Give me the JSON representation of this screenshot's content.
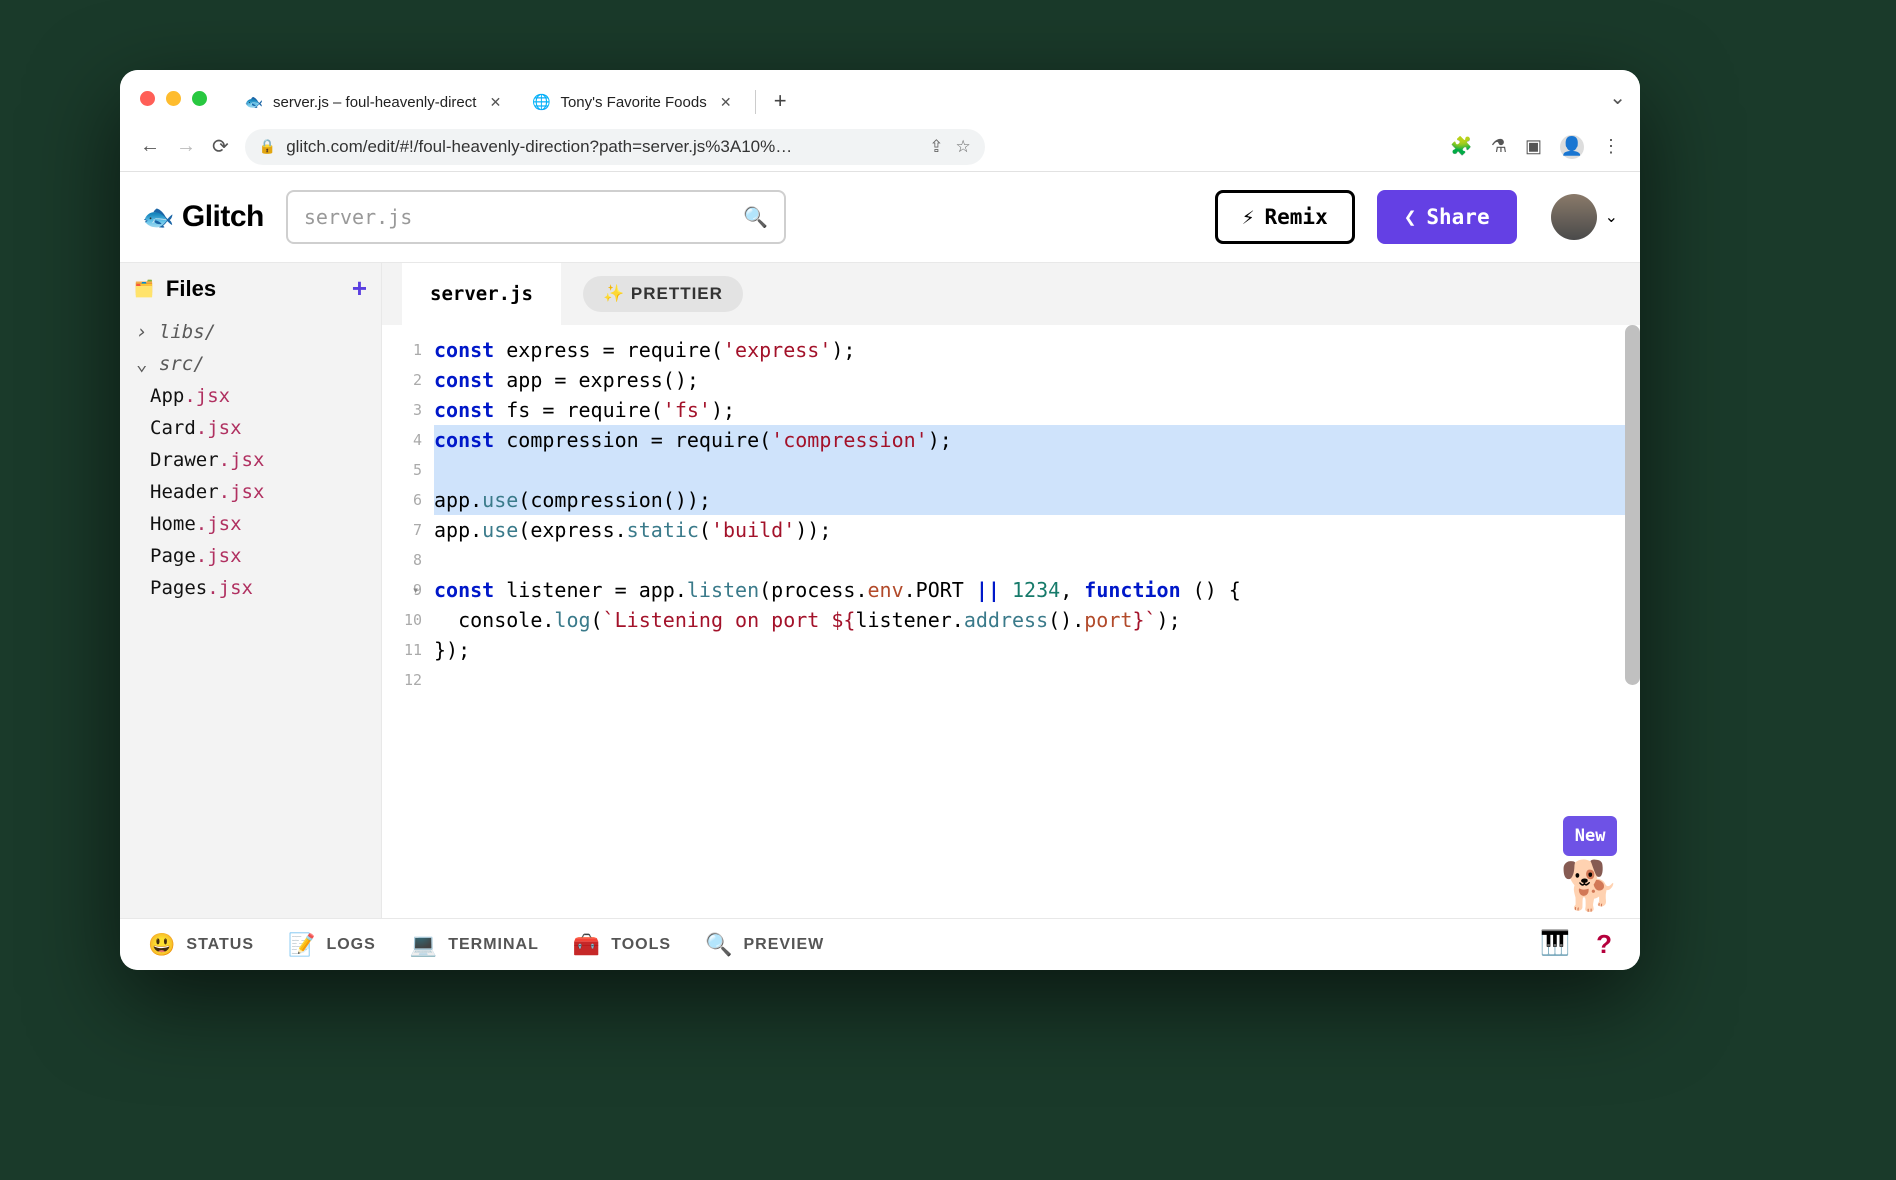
{
  "browser": {
    "tabs": [
      {
        "label": "server.js – foul-heavenly-direct",
        "active": true
      },
      {
        "label": "Tony's Favorite Foods",
        "active": false
      }
    ],
    "url": "glitch.com/edit/#!/foul-heavenly-direction?path=server.js%3A10%…"
  },
  "header": {
    "logo": "Glitch",
    "search_placeholder": "server.js",
    "remix_label": "Remix",
    "share_label": "Share"
  },
  "sidebar": {
    "title": "Files",
    "folders": [
      {
        "name": "libs/",
        "expanded": false
      },
      {
        "name": "src/",
        "expanded": true,
        "files": [
          {
            "base": "App",
            "ext": ".jsx"
          },
          {
            "base": "Card",
            "ext": ".jsx"
          },
          {
            "base": "Drawer",
            "ext": ".jsx"
          },
          {
            "base": "Header",
            "ext": ".jsx"
          },
          {
            "base": "Home",
            "ext": ".jsx"
          },
          {
            "base": "Page",
            "ext": ".jsx"
          },
          {
            "base": "Pages",
            "ext": ".jsx"
          }
        ]
      }
    ]
  },
  "editor": {
    "tab": "server.js",
    "prettier": "PRETTIER",
    "lines": [
      {
        "n": 1,
        "hl": false,
        "segs": [
          [
            "kw",
            "const"
          ],
          [
            "",
            " express = require("
          ],
          [
            "str",
            "'express'"
          ],
          [
            "",
            ");"
          ]
        ]
      },
      {
        "n": 2,
        "hl": false,
        "segs": [
          [
            "kw",
            "const"
          ],
          [
            "",
            " app = express();"
          ]
        ]
      },
      {
        "n": 3,
        "hl": false,
        "segs": [
          [
            "kw",
            "const"
          ],
          [
            "",
            " fs = require("
          ],
          [
            "str",
            "'fs'"
          ],
          [
            "",
            ");"
          ]
        ]
      },
      {
        "n": 4,
        "hl": true,
        "segs": [
          [
            "kw",
            "const"
          ],
          [
            "",
            " compression = require("
          ],
          [
            "str",
            "'compression'"
          ],
          [
            "",
            ");"
          ]
        ]
      },
      {
        "n": 5,
        "hl": true,
        "segs": [
          [
            "",
            ""
          ]
        ]
      },
      {
        "n": 6,
        "hl": true,
        "segs": [
          [
            "",
            "app."
          ],
          [
            "fn",
            "use"
          ],
          [
            "",
            "(compression());"
          ]
        ]
      },
      {
        "n": 7,
        "hl": false,
        "segs": [
          [
            "",
            "app."
          ],
          [
            "fn",
            "use"
          ],
          [
            "",
            "(express."
          ],
          [
            "fn",
            "static"
          ],
          [
            "",
            "("
          ],
          [
            "str",
            "'build'"
          ],
          [
            "",
            "));"
          ]
        ]
      },
      {
        "n": 8,
        "hl": false,
        "segs": [
          [
            "",
            ""
          ]
        ]
      },
      {
        "n": 9,
        "hl": false,
        "fold": true,
        "segs": [
          [
            "kw",
            "const"
          ],
          [
            "",
            " listener = app."
          ],
          [
            "fn",
            "listen"
          ],
          [
            "",
            "(process."
          ],
          [
            "id",
            "env"
          ],
          [
            "",
            ".PORT "
          ],
          [
            "kw",
            "||"
          ],
          [
            "",
            " "
          ],
          [
            "num",
            "1234"
          ],
          [
            "",
            ", "
          ],
          [
            "kw",
            "function"
          ],
          [
            "",
            " () {"
          ]
        ]
      },
      {
        "n": 10,
        "hl": false,
        "segs": [
          [
            "",
            "  console."
          ],
          [
            "fn",
            "log"
          ],
          [
            "",
            "("
          ],
          [
            "str",
            "`Listening on port ${"
          ],
          [
            "",
            "listener."
          ],
          [
            "fn",
            "address"
          ],
          [
            "",
            "()."
          ],
          [
            "id",
            "port"
          ],
          [
            "str",
            "}`"
          ],
          [
            "",
            ");"
          ]
        ]
      },
      {
        "n": 11,
        "hl": false,
        "segs": [
          [
            "",
            "});"
          ]
        ]
      },
      {
        "n": 12,
        "hl": false,
        "segs": [
          [
            "",
            ""
          ]
        ]
      }
    ],
    "mascot_badge": "New"
  },
  "footer": {
    "items": [
      "STATUS",
      "LOGS",
      "TERMINAL",
      "TOOLS",
      "PREVIEW"
    ],
    "emojis": [
      "😃",
      "📝",
      "💻",
      "🧰",
      "🔍"
    ]
  }
}
